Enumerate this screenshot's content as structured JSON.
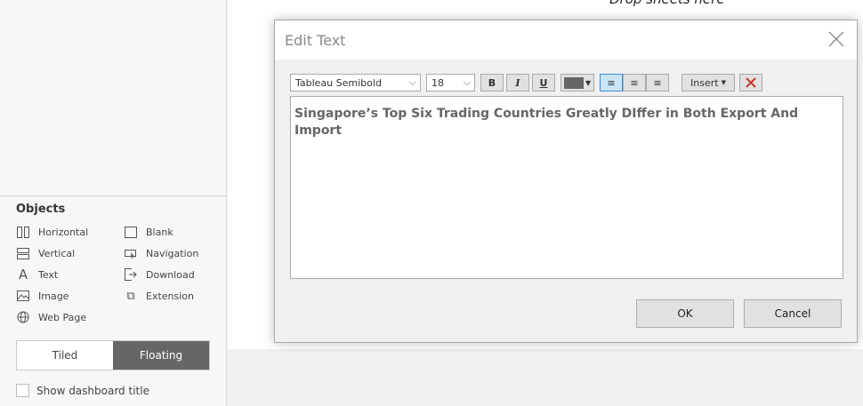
{
  "canvas": {
    "drop_hint": "Drop sheets here"
  },
  "objects": {
    "heading": "Objects",
    "items": [
      {
        "label": "Horizontal",
        "icon": "horizontal-container-icon"
      },
      {
        "label": "Blank",
        "icon": "blank-icon"
      },
      {
        "label": "Vertical",
        "icon": "vertical-container-icon"
      },
      {
        "label": "Navigation",
        "icon": "navigation-icon"
      },
      {
        "label": "Text",
        "icon": "text-icon"
      },
      {
        "label": "Download",
        "icon": "download-icon"
      },
      {
        "label": "Image",
        "icon": "image-icon"
      },
      {
        "label": "Extension",
        "icon": "extension-icon"
      },
      {
        "label": "Web Page",
        "icon": "globe-icon"
      }
    ],
    "tiled": "Tiled",
    "floating": "Floating",
    "show_title": "Show dashboard title"
  },
  "dialog": {
    "title": "Edit Text",
    "font": "Tableau Semibold",
    "size": "18",
    "bold": "B",
    "italic": "I",
    "underline": "U",
    "insert": "Insert",
    "text_color": "#666666",
    "content": "Singapore’s Top Six Trading Countries Greatly DIffer in Both Export And Import",
    "ok": "OK",
    "cancel": "Cancel"
  }
}
